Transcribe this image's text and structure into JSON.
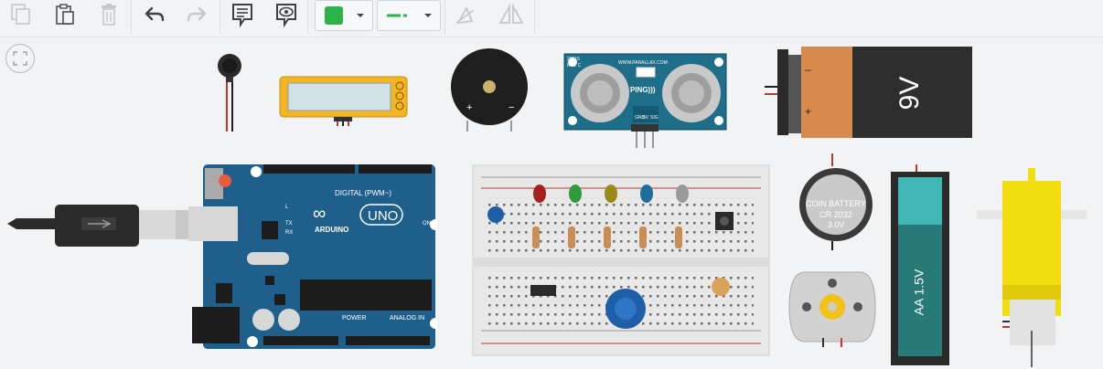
{
  "toolbar": {
    "items": [
      "copy-icon",
      "paste-icon",
      "delete-icon",
      "undo-icon",
      "redo-icon",
      "notes-icon",
      "view-icon",
      "fill-color-swatch",
      "line-style-swatch",
      "rotate-icon",
      "mirror-icon"
    ],
    "fill_color": "#2eb34a",
    "line_color": "#2eb34a"
  },
  "components": {
    "battery_9v": {
      "label": "9V",
      "minus": "–",
      "plus": "+"
    },
    "ultrasonic": {
      "brand": "WWW.PARALLAX.COM",
      "model": "28015",
      "rev": "REV C",
      "ping": "PING)))",
      "pins": [
        "GND",
        "5V",
        "SIG"
      ]
    },
    "arduino": {
      "digital_label": "DIGITAL (PWM~)",
      "uno": "UNO",
      "brand": "ARDUINO",
      "power_label": "POWER",
      "analog_label": "ANALOG IN",
      "tx": "TX",
      "rx": "RX",
      "on": "ON",
      "l": "L"
    },
    "coin_battery": {
      "line1": "COIN BATTERY",
      "line2": "CR 2032",
      "line3": "3.0V"
    },
    "aa_battery": {
      "label": "AA 1.5V"
    }
  },
  "colors": {
    "arduino_blue": "#1f5f8b",
    "battery_orange": "#d88a4d",
    "breadboard": "#e8e8e8",
    "motor_yellow": "#f2dd0f",
    "aa_teal": "#3fb7b5"
  }
}
